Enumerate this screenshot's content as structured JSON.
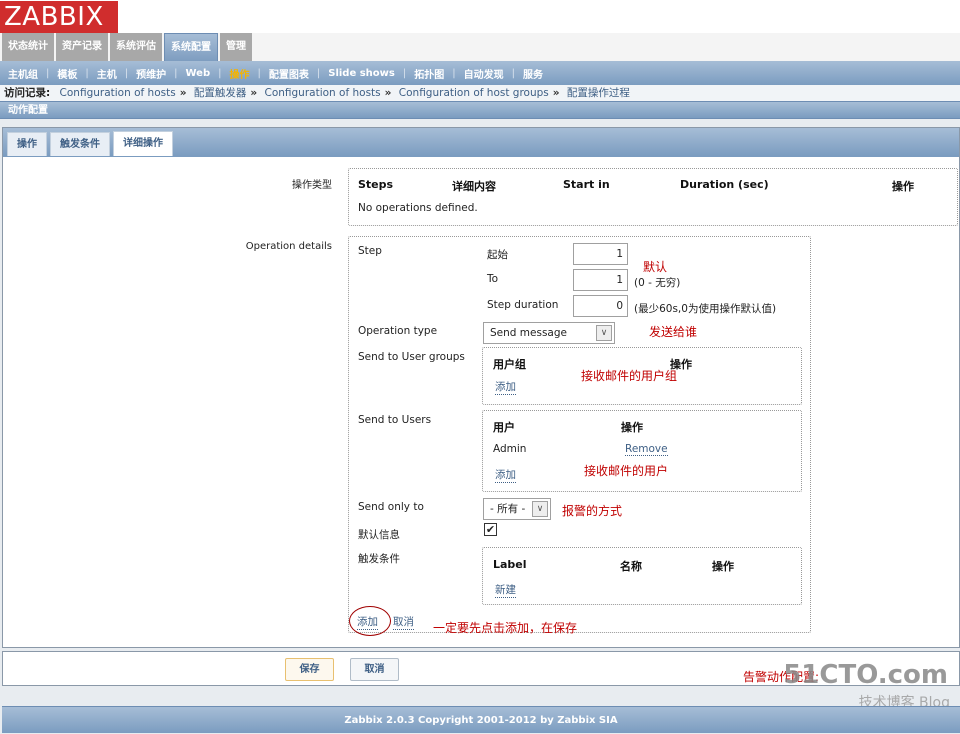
{
  "app": {
    "logo": "ZABBIX"
  },
  "main_menu": [
    {
      "label": "状态统计",
      "active": false
    },
    {
      "label": "资产记录",
      "active": false
    },
    {
      "label": "系统评估",
      "active": false
    },
    {
      "label": "系统配置",
      "active": true
    },
    {
      "label": "管理",
      "active": false
    }
  ],
  "sub_menu": [
    {
      "label": "主机组",
      "active": false
    },
    {
      "label": "模板",
      "active": false
    },
    {
      "label": "主机",
      "active": false
    },
    {
      "label": "预维护",
      "active": false
    },
    {
      "label": "Web",
      "active": false
    },
    {
      "label": "操作",
      "active": true
    },
    {
      "label": "配置图表",
      "active": false
    },
    {
      "label": "Slide shows",
      "active": false
    },
    {
      "label": "拓扑图",
      "active": false
    },
    {
      "label": "自动发现",
      "active": false
    },
    {
      "label": "服务",
      "active": false
    }
  ],
  "history": {
    "label": "访问记录:",
    "items": [
      "Configuration of hosts",
      "配置触发器",
      "Configuration of hosts",
      "Configuration of host groups",
      "配置操作过程"
    ],
    "separator": "»"
  },
  "section_title": "动作配置",
  "tabs": [
    {
      "label": "操作",
      "active": false
    },
    {
      "label": "触发条件",
      "active": false
    },
    {
      "label": "详细操作",
      "active": true
    }
  ],
  "operations": {
    "label": "操作类型",
    "columns": [
      "Steps",
      "详细内容",
      "Start in",
      "Duration (sec)",
      "操作"
    ],
    "empty_text": "No operations defined."
  },
  "details": {
    "label": "Operation details",
    "step_label": "Step",
    "from_label": "起始",
    "from_value": "1",
    "to_label": "To",
    "to_value": "1",
    "to_hint": "(0 - 无穷)",
    "duration_label": "Step duration",
    "duration_value": "0",
    "duration_hint": "(最少60s,0为使用操作默认值)",
    "optype_label": "Operation type",
    "optype_value": "Send message",
    "usergroups_label": "Send to User groups",
    "usergroups_columns": [
      "用户组",
      "操作"
    ],
    "usergroups_add": "添加",
    "users_label": "Send to Users",
    "users_columns": [
      "用户",
      "操作"
    ],
    "users_rows": [
      {
        "name": "Admin",
        "action": "Remove"
      }
    ],
    "users_add": "添加",
    "sendonly_label": "Send only to",
    "sendonly_value": "- 所有 -",
    "default_msg_label": "默认信息",
    "default_msg_checked": true,
    "conditions_label": "触发条件",
    "conditions_columns": [
      "Label",
      "名称",
      "操作"
    ],
    "conditions_new": "新建",
    "add_link": "添加",
    "cancel_link": "取消"
  },
  "annotations": {
    "default": "默认",
    "send_to_whom": "发送给谁",
    "user_groups": "接收邮件的用户组",
    "users": "接收邮件的用户",
    "method": "报警的方式",
    "must_add": "一定要先点击添加，在保存",
    "title": "告警动作配置:"
  },
  "buttons": {
    "save": "保存",
    "cancel": "取消"
  },
  "footer": "Zabbix 2.0.3 Copyright 2001-2012 by Zabbix SIA",
  "watermark": {
    "main": "51CTO.com",
    "sub": "技术博客 Blog"
  }
}
